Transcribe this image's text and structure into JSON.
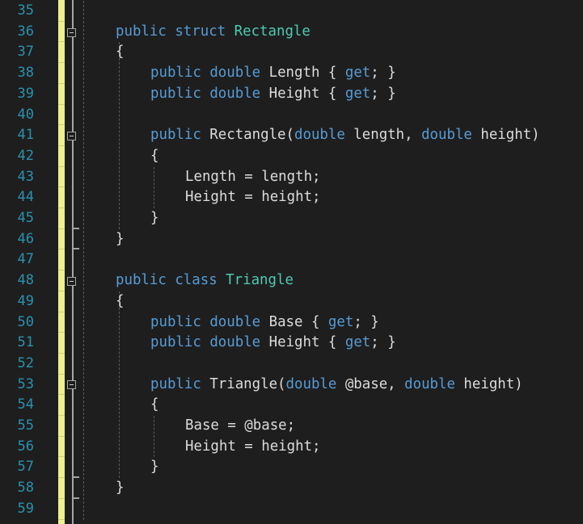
{
  "editor": {
    "colors": {
      "background": "#1e1e1e",
      "line_number": "#2b91af",
      "keyword": "#569cd6",
      "type": "#4ec9b0",
      "identifier": "#dcdcdc",
      "change_bar": "#eff08e"
    },
    "lines": [
      {
        "number": "35",
        "indent": 0,
        "tokens": []
      },
      {
        "number": "36",
        "indent": 1,
        "fold": "start",
        "tokens": [
          {
            "t": "public",
            "c": "kw"
          },
          {
            "t": " "
          },
          {
            "t": "struct",
            "c": "kw"
          },
          {
            "t": " "
          },
          {
            "t": "Rectangle",
            "c": "type"
          }
        ]
      },
      {
        "number": "37",
        "indent": 1,
        "tokens": [
          {
            "t": "{"
          }
        ]
      },
      {
        "number": "38",
        "indent": 2,
        "tokens": [
          {
            "t": "public",
            "c": "kw"
          },
          {
            "t": " "
          },
          {
            "t": "double",
            "c": "kw"
          },
          {
            "t": " Length { "
          },
          {
            "t": "get",
            "c": "kw"
          },
          {
            "t": "; }"
          }
        ]
      },
      {
        "number": "39",
        "indent": 2,
        "tokens": [
          {
            "t": "public",
            "c": "kw"
          },
          {
            "t": " "
          },
          {
            "t": "double",
            "c": "kw"
          },
          {
            "t": " Height { "
          },
          {
            "t": "get",
            "c": "kw"
          },
          {
            "t": "; }"
          }
        ]
      },
      {
        "number": "40",
        "indent": 0,
        "tokens": []
      },
      {
        "number": "41",
        "indent": 2,
        "fold": "start",
        "tokens": [
          {
            "t": "public",
            "c": "kw"
          },
          {
            "t": " Rectangle("
          },
          {
            "t": "double",
            "c": "kw"
          },
          {
            "t": " length, "
          },
          {
            "t": "double",
            "c": "kw"
          },
          {
            "t": " height)"
          }
        ]
      },
      {
        "number": "42",
        "indent": 2,
        "tokens": [
          {
            "t": "{"
          }
        ]
      },
      {
        "number": "43",
        "indent": 3,
        "tokens": [
          {
            "t": "Length = length;"
          }
        ]
      },
      {
        "number": "44",
        "indent": 3,
        "tokens": [
          {
            "t": "Height = height;"
          }
        ]
      },
      {
        "number": "45",
        "indent": 2,
        "fold": "end",
        "tokens": [
          {
            "t": "}"
          }
        ]
      },
      {
        "number": "46",
        "indent": 1,
        "fold": "end",
        "tokens": [
          {
            "t": "}"
          }
        ]
      },
      {
        "number": "47",
        "indent": 0,
        "tokens": []
      },
      {
        "number": "48",
        "indent": 1,
        "fold": "start",
        "tokens": [
          {
            "t": "public",
            "c": "kw"
          },
          {
            "t": " "
          },
          {
            "t": "class",
            "c": "kw"
          },
          {
            "t": " "
          },
          {
            "t": "Triangle",
            "c": "type"
          }
        ]
      },
      {
        "number": "49",
        "indent": 1,
        "tokens": [
          {
            "t": "{"
          }
        ]
      },
      {
        "number": "50",
        "indent": 2,
        "tokens": [
          {
            "t": "public",
            "c": "kw"
          },
          {
            "t": " "
          },
          {
            "t": "double",
            "c": "kw"
          },
          {
            "t": " Base { "
          },
          {
            "t": "get",
            "c": "kw"
          },
          {
            "t": "; }"
          }
        ]
      },
      {
        "number": "51",
        "indent": 2,
        "tokens": [
          {
            "t": "public",
            "c": "kw"
          },
          {
            "t": " "
          },
          {
            "t": "double",
            "c": "kw"
          },
          {
            "t": " Height { "
          },
          {
            "t": "get",
            "c": "kw"
          },
          {
            "t": "; }"
          }
        ]
      },
      {
        "number": "52",
        "indent": 0,
        "tokens": []
      },
      {
        "number": "53",
        "indent": 2,
        "fold": "start",
        "tokens": [
          {
            "t": "public",
            "c": "kw"
          },
          {
            "t": " Triangle("
          },
          {
            "t": "double",
            "c": "kw"
          },
          {
            "t": " @base, "
          },
          {
            "t": "double",
            "c": "kw"
          },
          {
            "t": " height)"
          }
        ]
      },
      {
        "number": "54",
        "indent": 2,
        "tokens": [
          {
            "t": "{"
          }
        ]
      },
      {
        "number": "55",
        "indent": 3,
        "tokens": [
          {
            "t": "Base = @base;"
          }
        ]
      },
      {
        "number": "56",
        "indent": 3,
        "tokens": [
          {
            "t": "Height = height;"
          }
        ]
      },
      {
        "number": "57",
        "indent": 2,
        "fold": "end",
        "tokens": [
          {
            "t": "}"
          }
        ]
      },
      {
        "number": "58",
        "indent": 1,
        "fold": "end",
        "tokens": [
          {
            "t": "}"
          }
        ]
      },
      {
        "number": "59",
        "indent": 0,
        "tokens": []
      }
    ]
  }
}
